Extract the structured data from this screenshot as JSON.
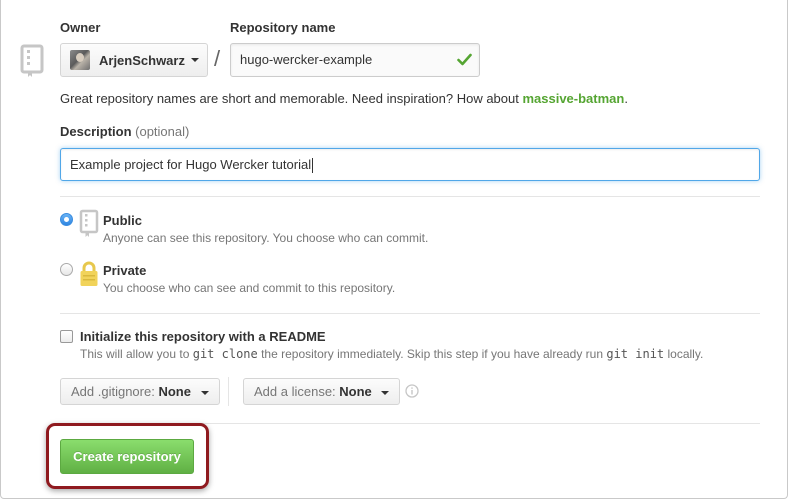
{
  "owner": {
    "label": "Owner",
    "name": "ArjenSchwarz"
  },
  "repository": {
    "label": "Repository name",
    "separator": "/",
    "value": "hugo-wercker-example"
  },
  "hint": {
    "text": "Great repository names are short and memorable. Need inspiration? How about ",
    "suggestion": "massive-batman",
    "end": "."
  },
  "description": {
    "label": "Description",
    "optional": "(optional)",
    "value": "Example project for Hugo Wercker tutorial"
  },
  "visibility": {
    "public": {
      "title": "Public",
      "subtitle": "Anyone can see this repository. You choose who can commit.",
      "selected": true
    },
    "private": {
      "title": "Private",
      "subtitle": "You choose who can see and commit to this repository.",
      "selected": false
    }
  },
  "readme": {
    "title": "Initialize this repository with a README",
    "sub_pre": "This will allow you to ",
    "cmd_clone": "git clone",
    "sub_mid": " the repository immediately. Skip this step if you have already run ",
    "cmd_init": "git init",
    "sub_post": " locally.",
    "checked": false
  },
  "gitignore": {
    "prefix": "Add .gitignore: ",
    "value": "None"
  },
  "license": {
    "prefix": "Add a license: ",
    "value": "None"
  },
  "create_button": "Create repository",
  "colors": {
    "accent_green": "#55a532",
    "button_green": "#60b044",
    "focus_blue": "#51a7e8",
    "highlight_red": "#8f1a1f"
  },
  "icons": [
    "repo-icon",
    "check-icon",
    "book-icon",
    "lock-icon",
    "info-icon",
    "caret-down-icon"
  ]
}
